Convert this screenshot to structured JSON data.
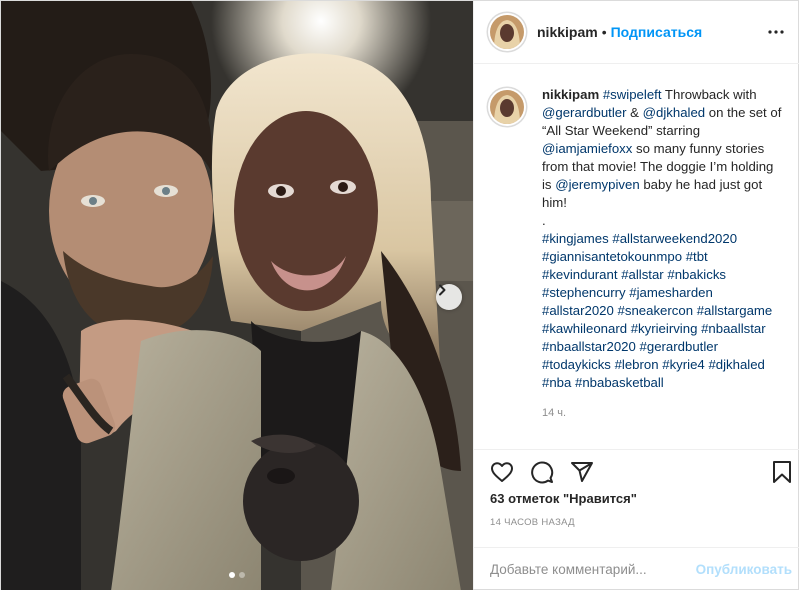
{
  "post": {
    "username": "nikkipam",
    "separator": "•",
    "follow_label": "Подписаться",
    "more_icon": "more-icon"
  },
  "caption": {
    "username": "nikkipam",
    "text_parts": [
      {
        "t": "#swipeleft",
        "tag": true
      },
      {
        "t": " Throwback with ",
        "tag": false
      },
      {
        "t": "@gerardbutler",
        "tag": true
      },
      {
        "t": " & ",
        "tag": false
      },
      {
        "t": "@djkhaled",
        "tag": true
      },
      {
        "t": " on the set of “All Star Weekend” starring ",
        "tag": false
      },
      {
        "t": "@iamjamiefoxx",
        "tag": true
      },
      {
        "t": " so many funny stories from that movie! The doggie I’m holding is ",
        "tag": false
      },
      {
        "t": "@jeremypiven",
        "tag": true
      },
      {
        "t": " baby he had just got him!",
        "tag": false
      }
    ],
    "dot_line": ".",
    "hashtags": [
      "#kingjames",
      "#allstarweekend2020",
      "#giannisantetokounmpo",
      "#tbt",
      "#kevindurant",
      "#allstar",
      "#nbakicks",
      "#stephencurry",
      "#jamesharden",
      "#allstar2020",
      "#sneakercon",
      "#allstargame",
      "#kawhileonard",
      "#kyrieirving",
      "#nbaallstar",
      "#nbaallstar2020",
      "#gerardbutler",
      "#todaykicks",
      "#lebron",
      "#kyrie4",
      "#djkhaled",
      "#nba",
      "#nbabasketball"
    ],
    "time": "14 ч."
  },
  "actions": {
    "like_icon": "heart-icon",
    "comment_icon": "comment-icon",
    "share_icon": "share-icon",
    "save_icon": "bookmark-icon"
  },
  "likes_text": "63 отметок \"Нравится\"",
  "posted_ago": "14 ЧАСОВ НАЗАД",
  "comment": {
    "placeholder": "Добавьте комментарий...",
    "publish_label": "Опубликовать"
  },
  "carousel": {
    "next_icon": "chevron-right-icon",
    "total": 2,
    "current": 1
  },
  "colors": {
    "accent": "#0095f6",
    "hashtag": "#00376b",
    "publish_disabled": "#b2dffc",
    "secondary_text": "#8e8e8e"
  }
}
